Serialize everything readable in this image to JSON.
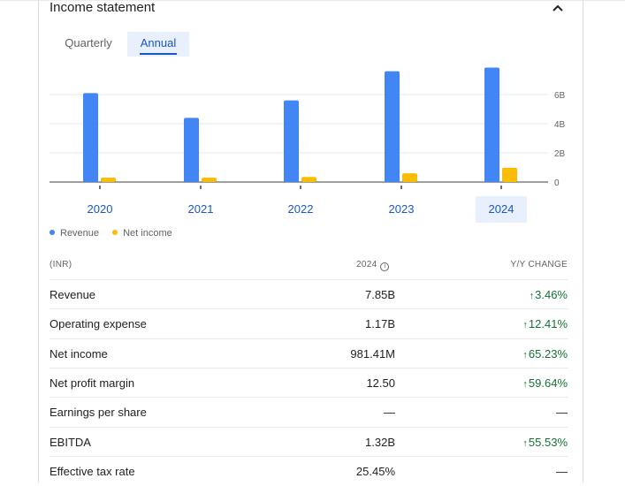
{
  "header": {
    "title": "Income statement"
  },
  "tabs": [
    {
      "label": "Quarterly",
      "selected": false
    },
    {
      "label": "Annual",
      "selected": true
    }
  ],
  "chart_data": {
    "type": "bar",
    "categories": [
      "2020",
      "2021",
      "2022",
      "2023",
      "2024"
    ],
    "series": [
      {
        "name": "Revenue",
        "color": "#4285f4",
        "values": [
          6.1,
          4.4,
          5.6,
          7.6,
          7.85
        ]
      },
      {
        "name": "Net income",
        "color": "#fbbc04",
        "values": [
          0.3,
          0.3,
          0.35,
          0.6,
          0.98
        ]
      }
    ],
    "y_ticks": [
      "0",
      "2B",
      "4B",
      "6B"
    ],
    "ylim": [
      0,
      8
    ],
    "selected_category": "2024"
  },
  "legend": [
    {
      "label": "Revenue",
      "color": "#4285f4"
    },
    {
      "label": "Net income",
      "color": "#fbbc04"
    }
  ],
  "table": {
    "currency_label": "(INR)",
    "year_label": "2024",
    "change_label": "Y/Y CHANGE",
    "rows": [
      {
        "label": "Revenue",
        "value": "7.85B",
        "change": "3.46%"
      },
      {
        "label": "Operating expense",
        "value": "1.17B",
        "change": "12.41%"
      },
      {
        "label": "Net income",
        "value": "981.41M",
        "change": "65.23%"
      },
      {
        "label": "Net profit margin",
        "value": "12.50",
        "change": "59.64%"
      },
      {
        "label": "Earnings per share",
        "value": "—",
        "change": "—"
      },
      {
        "label": "EBITDA",
        "value": "1.32B",
        "change": "55.53%"
      },
      {
        "label": "Effective tax rate",
        "value": "25.45%",
        "change": "—"
      }
    ]
  }
}
